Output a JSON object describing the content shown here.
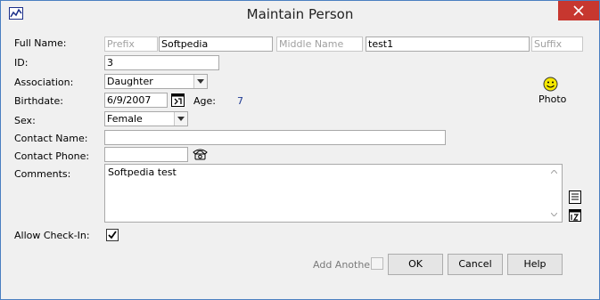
{
  "window": {
    "title": "Maintain Person",
    "app_icon": "chart-icon",
    "close_icon": "close-icon"
  },
  "labels": {
    "full_name": "Full Name:",
    "id": "ID:",
    "association": "Association:",
    "birthdate": "Birthdate:",
    "age": "Age:",
    "sex": "Sex:",
    "contact_name": "Contact Name:",
    "contact_phone": "Contact Phone:",
    "comments": "Comments:",
    "allow_checkin": "Allow Check-In:",
    "photo": "Photo"
  },
  "fields": {
    "prefix": {
      "value": "",
      "placeholder": "Prefix"
    },
    "first_name": {
      "value": "Softpedia"
    },
    "middle_name": {
      "value": "",
      "placeholder": "Middle Name"
    },
    "last_name": {
      "value": "test1"
    },
    "suffix": {
      "value": "",
      "placeholder": "Suffix"
    },
    "id": {
      "value": "3"
    },
    "association": {
      "selected": "Daughter"
    },
    "birthdate": {
      "value": "6/9/2007"
    },
    "age": {
      "value": "7"
    },
    "sex": {
      "selected": "Female"
    },
    "contact_name": {
      "value": ""
    },
    "contact_phone": {
      "value": ""
    },
    "comments": {
      "value": "Softpedia test"
    },
    "allow_checkin": {
      "checked": true
    }
  },
  "footer": {
    "add_another_label": "Add Another",
    "add_another_checked": false,
    "ok_label": "OK",
    "cancel_label": "Cancel",
    "help_label": "Help"
  },
  "colors": {
    "age_value": "#1f3a93",
    "close_button": "#c7372f",
    "window_border": "#4a7fc1"
  }
}
